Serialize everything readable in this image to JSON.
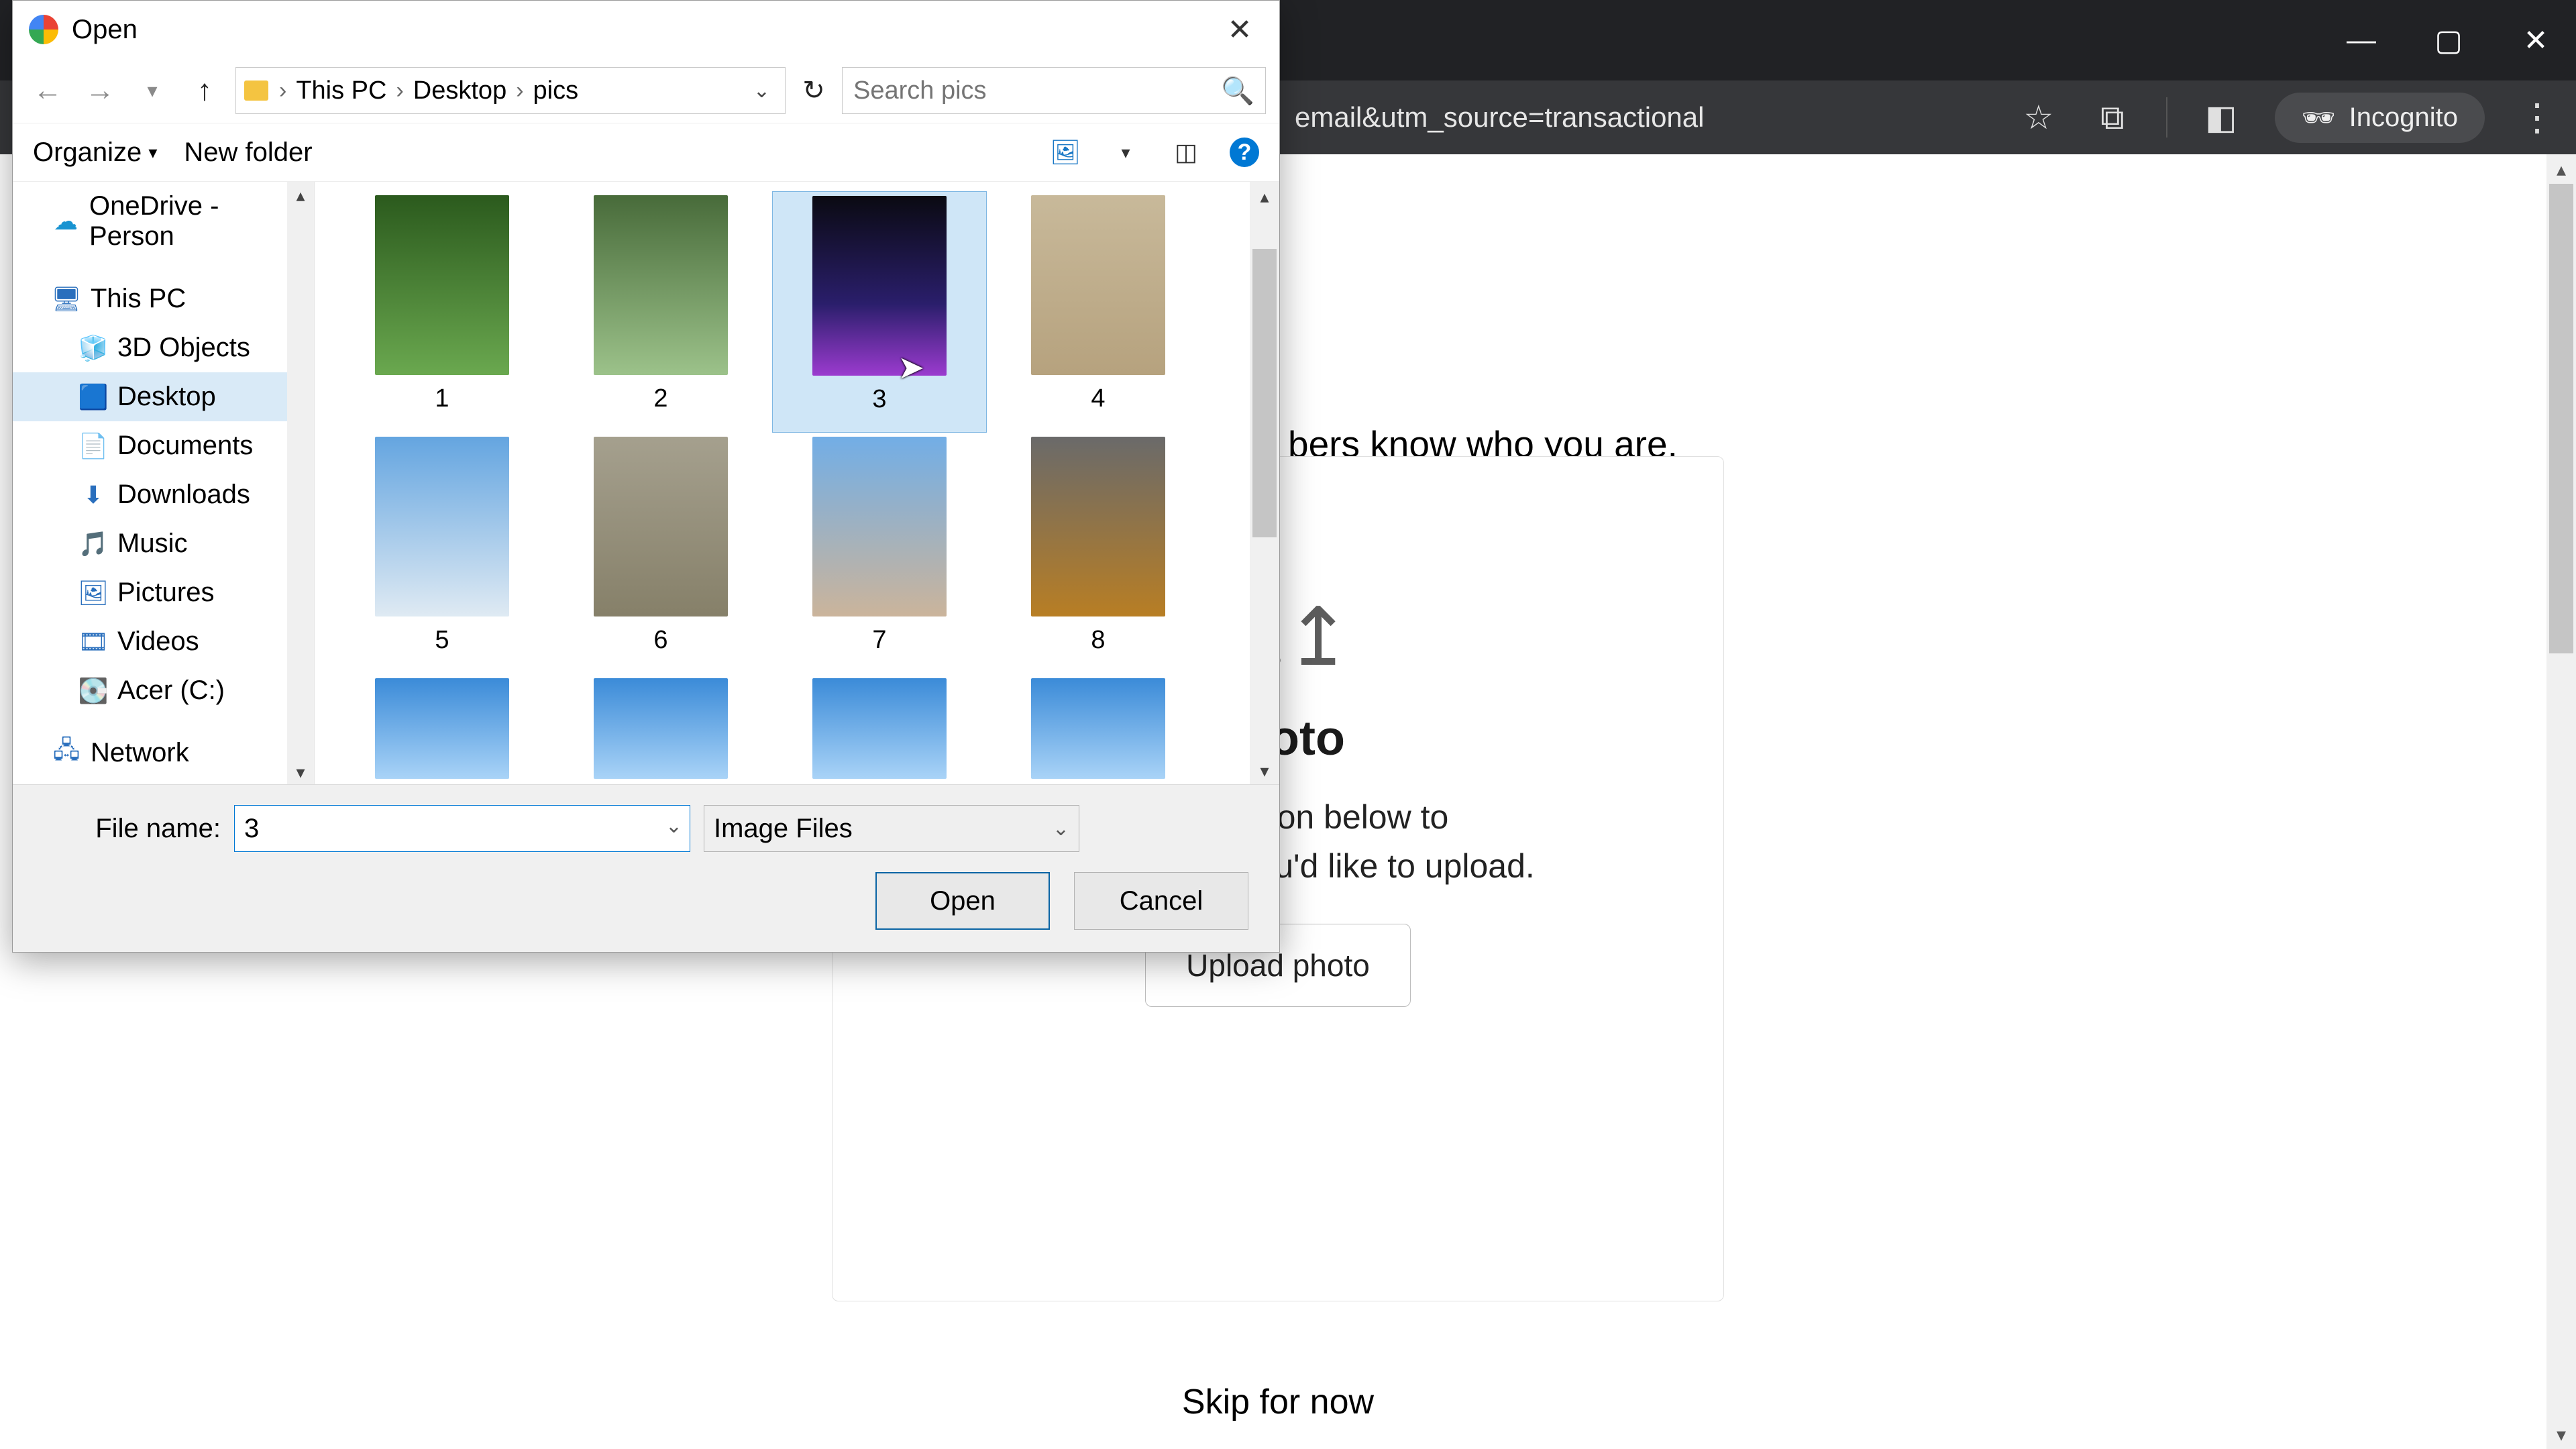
{
  "chrome": {
    "url_partial": "email&utm_source=transactional",
    "incognito_label": "Incognito",
    "win": {
      "minimize": "—",
      "maximize": "▢",
      "close": "✕"
    }
  },
  "page": {
    "headline_partial": "bers know who you are.",
    "card_heading_partial": "photo",
    "card_body_line1_partial": "lick the button below to",
    "card_body_line2": "select a photo you'd like to upload.",
    "upload_button": "Upload photo",
    "skip": "Skip for now"
  },
  "dialog": {
    "title": "Open",
    "nav": {
      "crumbs": [
        "This PC",
        "Desktop",
        "pics"
      ],
      "search_placeholder": "Search pics"
    },
    "toolbar": {
      "organize": "Organize",
      "new_folder": "New folder"
    },
    "tree": [
      {
        "label": "OneDrive - Person",
        "level": 1,
        "icon": "cloud"
      },
      {
        "label": "This PC",
        "level": 1,
        "icon": "pc"
      },
      {
        "label": "3D Objects",
        "level": 2,
        "icon": "cube"
      },
      {
        "label": "Desktop",
        "level": 2,
        "icon": "desktop",
        "selected": true
      },
      {
        "label": "Documents",
        "level": 2,
        "icon": "doc"
      },
      {
        "label": "Downloads",
        "level": 2,
        "icon": "down"
      },
      {
        "label": "Music",
        "level": 2,
        "icon": "music"
      },
      {
        "label": "Pictures",
        "level": 2,
        "icon": "pic"
      },
      {
        "label": "Videos",
        "level": 2,
        "icon": "vid"
      },
      {
        "label": "Acer (C:)",
        "level": 2,
        "icon": "drive"
      },
      {
        "label": "Network",
        "level": 1,
        "icon": "net"
      }
    ],
    "files": [
      {
        "name": "1"
      },
      {
        "name": "2"
      },
      {
        "name": "3",
        "selected": true
      },
      {
        "name": "4"
      },
      {
        "name": "5"
      },
      {
        "name": "6"
      },
      {
        "name": "7"
      },
      {
        "name": "8"
      },
      {
        "name": ""
      },
      {
        "name": ""
      },
      {
        "name": ""
      },
      {
        "name": ""
      }
    ],
    "footer": {
      "file_name_label": "File name:",
      "file_name_value": "3",
      "type_filter": "Image Files",
      "open": "Open",
      "cancel": "Cancel"
    }
  }
}
